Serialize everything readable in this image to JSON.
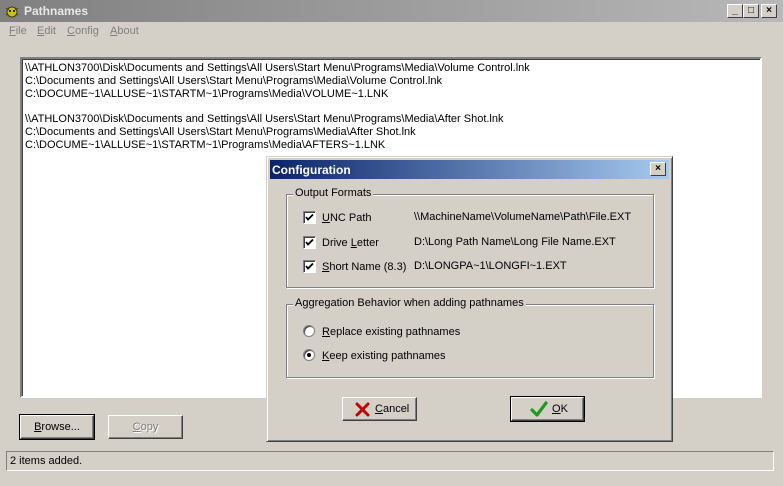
{
  "window": {
    "title": "Pathnames",
    "icon": "bug-icon",
    "controls": {
      "minimize": "_",
      "maximize": "□",
      "close": "×"
    }
  },
  "menu": {
    "items": [
      {
        "pre": "",
        "key": "F",
        "post": "ile"
      },
      {
        "pre": "",
        "key": "E",
        "post": "dit"
      },
      {
        "pre": "",
        "key": "C",
        "post": "onfig"
      },
      {
        "pre": "",
        "key": "A",
        "post": "bout"
      }
    ]
  },
  "paths": [
    [
      "\\\\ATHLON3700\\Disk\\Documents and Settings\\All Users\\Start Menu\\Programs\\Media\\Volume Control.lnk",
      "C:\\Documents and Settings\\All Users\\Start Menu\\Programs\\Media\\Volume Control.lnk",
      "C:\\DOCUME~1\\ALLUSE~1\\STARTM~1\\Programs\\Media\\VOLUME~1.LNK"
    ],
    [
      "\\\\ATHLON3700\\Disk\\Documents and Settings\\All Users\\Start Menu\\Programs\\Media\\After Shot.lnk",
      "C:\\Documents and Settings\\All Users\\Start Menu\\Programs\\Media\\After Shot.lnk",
      "C:\\DOCUME~1\\ALLUSE~1\\STARTM~1\\Programs\\Media\\AFTERS~1.LNK"
    ]
  ],
  "buttons": {
    "browse": {
      "key": "B",
      "rest": "rowse..."
    },
    "copy": {
      "key": "C",
      "rest": "opy"
    }
  },
  "status": "2 items added.",
  "dialog": {
    "title": "Configuration",
    "close": "×",
    "output_formats": {
      "legend": "Output Formats",
      "options": [
        {
          "key": "U",
          "rest": "NC Path",
          "pre": "",
          "example": "\\\\MachineName\\VolumeName\\Path\\File.EXT",
          "checked": true
        },
        {
          "key": "L",
          "rest": "etter",
          "pre": "Drive ",
          "example": "D:\\Long Path Name\\Long File Name.EXT",
          "checked": true
        },
        {
          "key": "S",
          "rest": "hort Name (8.3)",
          "pre": "",
          "example": "D:\\LONGPA~1\\LONGFI~1.EXT",
          "checked": true
        }
      ]
    },
    "aggregation": {
      "legend": "Aggregation Behavior when adding pathnames",
      "options": [
        {
          "key": "R",
          "rest": "eplace existing pathnames",
          "selected": false
        },
        {
          "key": "K",
          "rest": "eep existing pathnames",
          "selected": true
        }
      ]
    },
    "cancel": {
      "key": "C",
      "rest": "ancel",
      "icon": "red-x-icon"
    },
    "ok": {
      "key": "O",
      "rest": "K",
      "icon": "green-check-icon"
    }
  }
}
